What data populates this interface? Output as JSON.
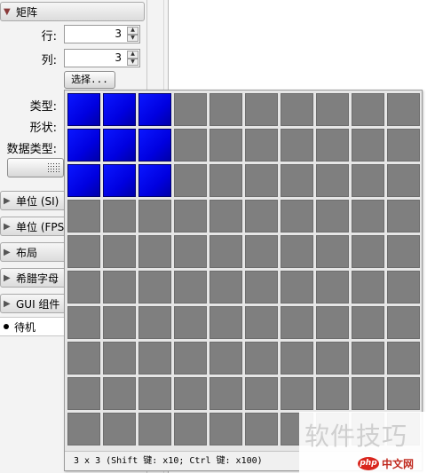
{
  "palette": {
    "matrix_header": "矩阵",
    "rows_label": "行:",
    "rows_value": "3",
    "cols_label": "列:",
    "cols_value": "3",
    "select_button": "选择...",
    "type_label": "类型:",
    "shape_label": "形状:",
    "datatype_label": "数据类型:",
    "sections": [
      {
        "label": "单位 (SI)"
      },
      {
        "label": "单位 (FPS"
      },
      {
        "label": "布局"
      },
      {
        "label": "希腊字母"
      },
      {
        "label": "GUI 组件"
      }
    ],
    "status": "待机"
  },
  "popup": {
    "columns": 10,
    "rows": 10,
    "selected_rows": 3,
    "selected_cols": 3,
    "footer": "3 x 3 (Shift 键: x10; Ctrl 键: x100)"
  },
  "watermark": {
    "text": "软件技巧",
    "badge": "php",
    "site": "中文网"
  },
  "colors": {
    "selected_cell": "#0000e0",
    "empty_cell": "#7f7f7f"
  }
}
